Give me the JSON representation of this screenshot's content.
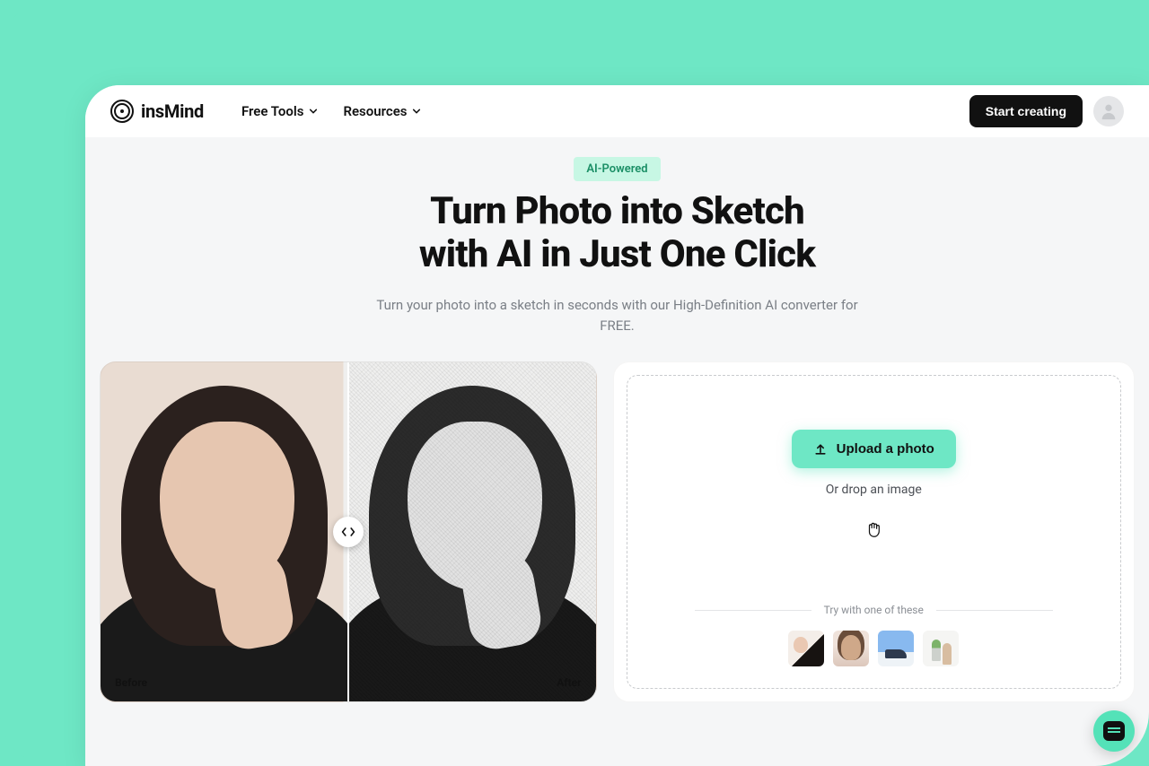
{
  "brand": {
    "name": "insMind"
  },
  "nav": {
    "items": [
      {
        "label": "Free Tools"
      },
      {
        "label": "Resources"
      }
    ]
  },
  "cta": {
    "label": "Start creating"
  },
  "hero": {
    "pill": "AI-Powered",
    "title_line1": "Turn Photo into Sketch",
    "title_line2": "with AI in Just One Click",
    "subtitle": "Turn your photo into a sketch in seconds with our High-Definition AI converter for FREE."
  },
  "preview": {
    "before_label": "Before",
    "after_label": "After"
  },
  "upload": {
    "button_label": "Upload a photo",
    "drop_text": "Or drop an image",
    "try_label": "Try with one of these"
  },
  "samples": [
    {
      "name": "sample-portrait-bw"
    },
    {
      "name": "sample-portrait-color"
    },
    {
      "name": "sample-landscape"
    },
    {
      "name": "sample-still-life"
    }
  ],
  "colors": {
    "accent": "#6ee7c5",
    "text": "#111111",
    "muted": "#7a7f86"
  }
}
